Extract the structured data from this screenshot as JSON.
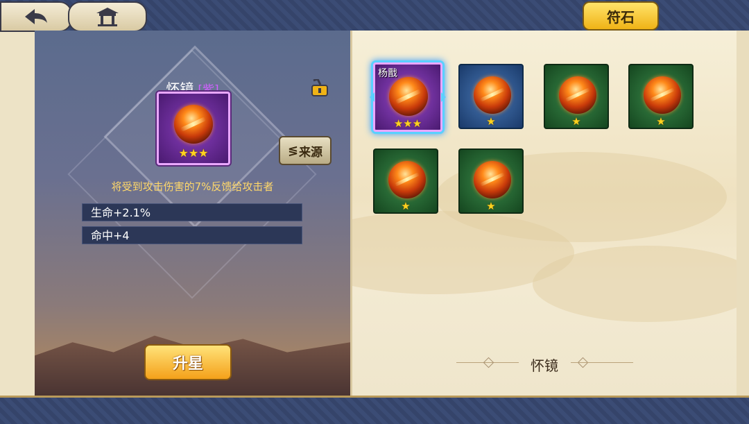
{
  "nav": {
    "back_icon": "back-arrow-icon",
    "home_icon": "home-pavilion-icon",
    "tab_label": "符石"
  },
  "detail": {
    "name": "怀镜",
    "grade_label": "[紫]",
    "lock_icon": "unlocked-padlock-icon",
    "stars": "★★★",
    "star_count": 3,
    "source_button": "来源",
    "description": "将受到攻击伤害的7%反馈给攻击者",
    "stats": [
      "生命+2.1%",
      "命中+4"
    ],
    "upgrade_button": "升星"
  },
  "inventory": {
    "items": [
      {
        "owner": "杨戬",
        "rarity": "purple",
        "stars": "★★★",
        "star_count": 3,
        "selected": true
      },
      {
        "owner": "",
        "rarity": "blue",
        "stars": "★",
        "star_count": 1,
        "selected": false
      },
      {
        "owner": "",
        "rarity": "green",
        "stars": "★",
        "star_count": 1,
        "selected": false
      },
      {
        "owner": "",
        "rarity": "green",
        "stars": "★",
        "star_count": 1,
        "selected": false
      },
      {
        "owner": "",
        "rarity": "green",
        "stars": "★",
        "star_count": 1,
        "selected": false
      },
      {
        "owner": "",
        "rarity": "green",
        "stars": "★",
        "star_count": 1,
        "selected": false
      }
    ],
    "selected_name": "怀镜"
  },
  "colors": {
    "accent_gold": "#f0b316",
    "purple_grade": "#d060ff",
    "description_text": "#ffd86a"
  }
}
